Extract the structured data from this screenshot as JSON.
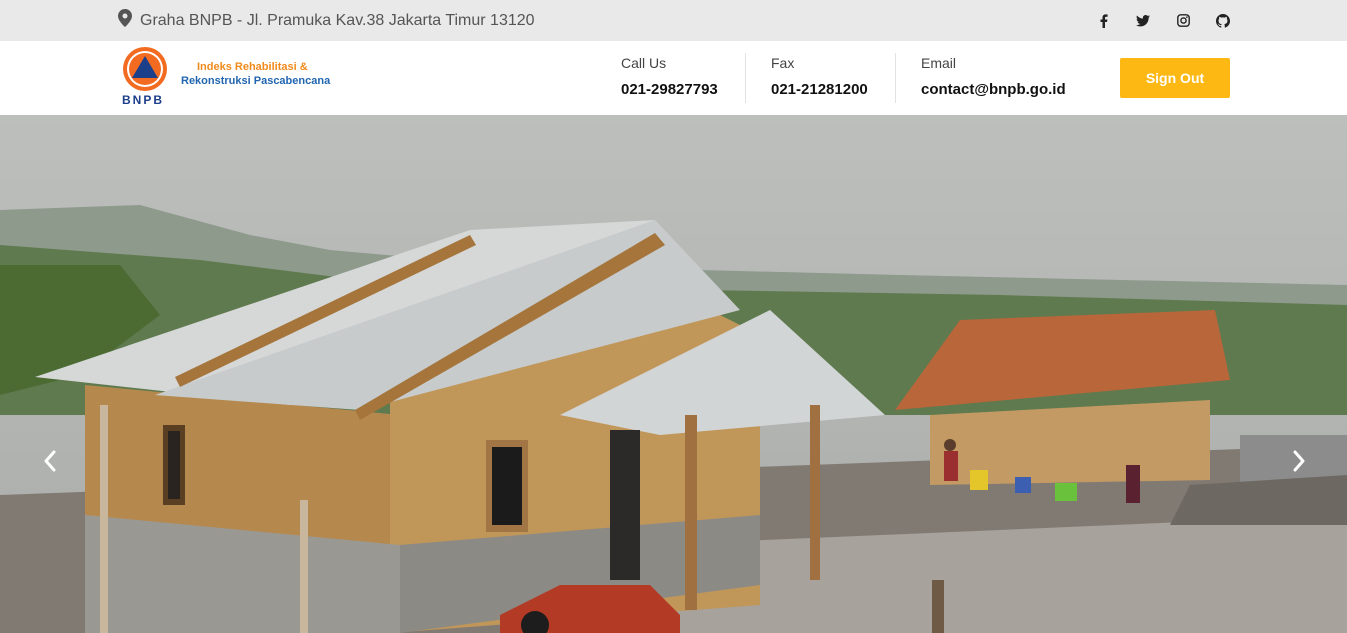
{
  "topbar": {
    "address": "Graha BNPB - Jl. Pramuka Kav.38 Jakarta Timur 13120",
    "address_icon": "map-pin-icon",
    "socials": [
      {
        "icon": "facebook-icon"
      },
      {
        "icon": "twitter-icon"
      },
      {
        "icon": "instagram-icon"
      },
      {
        "icon": "github-icon"
      }
    ]
  },
  "header": {
    "logo_text": "BNPB",
    "tagline_line1": "Indeks Rehabilitasi &",
    "tagline_line2": "Rekonstruksi Pascabencana",
    "contacts": [
      {
        "label": "Call Us",
        "value": "021-29827793"
      },
      {
        "label": "Fax",
        "value": "021-21281200"
      },
      {
        "label": "Email",
        "value": "contact@bnpb.go.id"
      }
    ],
    "signout_label": "Sign Out"
  },
  "carousel": {
    "prev_icon": "chevron-left-icon",
    "next_icon": "chevron-right-icon"
  },
  "colors": {
    "accent": "#fdb813",
    "topbar_bg": "#e9e9e9",
    "brand_orange": "#f08a1c",
    "brand_blue": "#2266b0"
  }
}
